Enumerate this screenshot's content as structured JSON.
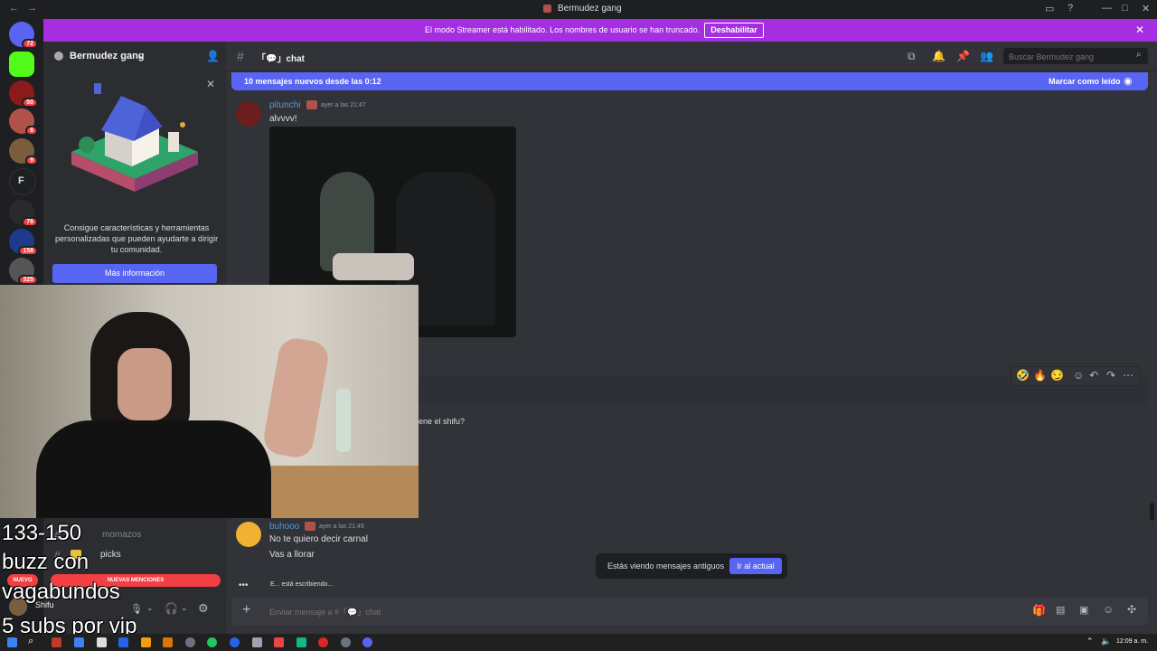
{
  "window": {
    "title": "Bermudez gang",
    "nav_back": "←",
    "nav_forward": "→"
  },
  "banner": {
    "message": "El modo Streamer está habilitado. Los nombres de usuario se han truncado.",
    "button": "Deshabilitar"
  },
  "servers": [
    {
      "badge": "72",
      "color": "#5865f2"
    },
    {
      "badge": "",
      "color": "#53fc18"
    },
    {
      "badge": "50",
      "color": "#8b1a1a"
    },
    {
      "badge": "8",
      "color": "#b0524a"
    },
    {
      "badge": "9",
      "color": "#7a5d3e"
    },
    {
      "badge": "",
      "color": "#1e1f22",
      "letter": "F"
    },
    {
      "badge": "76",
      "color": "#2a2a2a"
    },
    {
      "badge": "158",
      "color": "#1e3a8a"
    },
    {
      "badge": "325",
      "color": "#555"
    }
  ],
  "sidebar": {
    "guild_name": "Bermudez gang",
    "promo_text": "Consigue características y herramientas personalizadas que pueden ayudarte a dirigir tu comunidad.",
    "more_button": "Más información",
    "channels": [
      {
        "label": "momazos"
      },
      {
        "label": "picks"
      }
    ],
    "new_tag": "NUEVO",
    "mentions": "NUEVAS MENCIONES",
    "user": "Shifu"
  },
  "header": {
    "channel": "「💬」chat",
    "search_placeholder": "Buscar Bermudez gang"
  },
  "newbar": {
    "text": "10 mensajes nuevos desde las 0:12",
    "action": "Marcar como leído"
  },
  "messages": [
    {
      "user": "pitunchi",
      "time": "ayer a las 21:47",
      "text": "alvvvv!"
    },
    {
      "partial": "ene el shifu?"
    },
    {
      "user": "buhooo",
      "time": "ayer a las 21:49",
      "text": "No te quiero decir carnal",
      "text2": "Vas a llorar"
    }
  ],
  "typing": "E... está escribiendo...",
  "old_notice": {
    "text": "Estás viendo mensajes antiguos",
    "button": "Ir al actual"
  },
  "composer": {
    "placeholder": "Enviar mensaje a #「💬」chat"
  },
  "overlay": {
    "line1": "133-150",
    "line2": "buzz con",
    "line3": "vagabundos",
    "line4": "5 subs por vip"
  },
  "taskbar": {
    "clock": "12:09 a. m."
  },
  "colors": {
    "accent": "#5865f2",
    "streamer": "#a52ee0",
    "badge": "#f23f43"
  }
}
